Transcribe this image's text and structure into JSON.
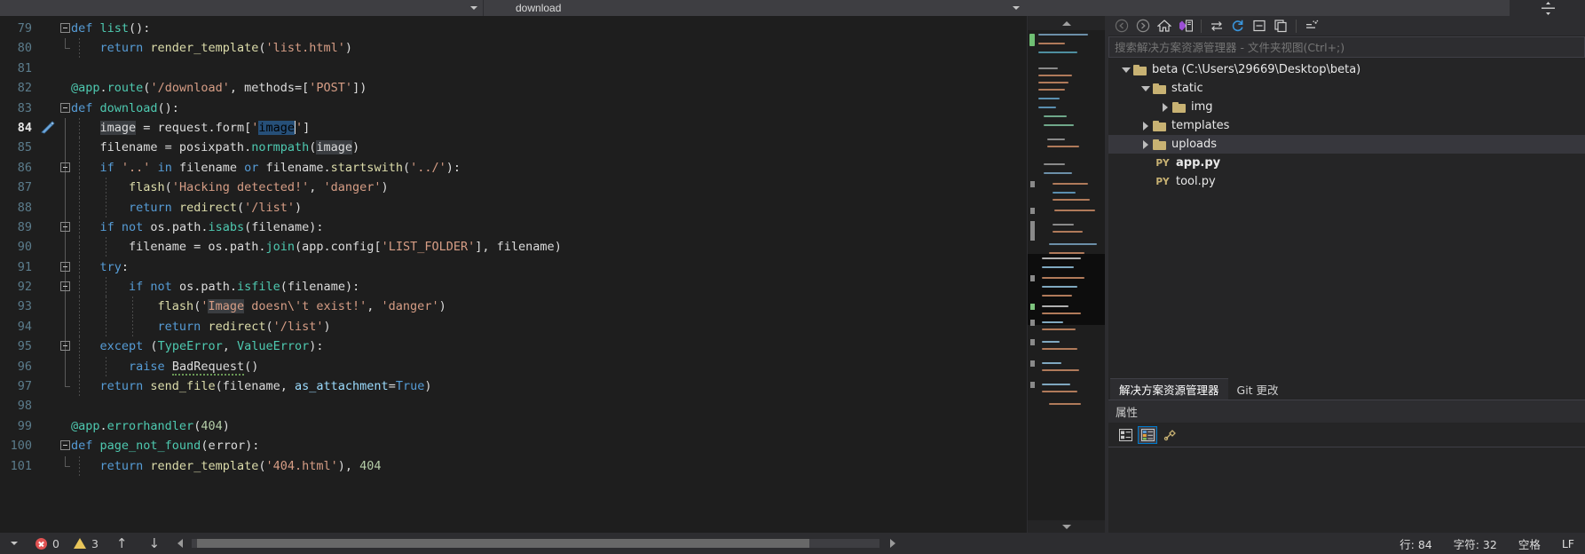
{
  "window": {
    "editor_tab_label": "download",
    "dropdown_icon": "caret-down-icon"
  },
  "editor": {
    "language": "python",
    "first_line_number": 79,
    "current_line": 84,
    "lines": [
      {
        "n": 79,
        "text": "def list():"
      },
      {
        "n": 80,
        "text": "    return render_template('list.html')"
      },
      {
        "n": 81,
        "text": ""
      },
      {
        "n": 82,
        "text": "@app.route('/download', methods=['POST'])"
      },
      {
        "n": 83,
        "text": "def download():"
      },
      {
        "n": 84,
        "text": "    image = request.form['image']"
      },
      {
        "n": 85,
        "text": "    filename = posixpath.normpath(image)"
      },
      {
        "n": 86,
        "text": "    if '..' in filename or filename.startswith('../'):"
      },
      {
        "n": 87,
        "text": "        flash('Hacking detected!', 'danger')"
      },
      {
        "n": 88,
        "text": "        return redirect('/list')"
      },
      {
        "n": 89,
        "text": "    if not os.path.isabs(filename):"
      },
      {
        "n": 90,
        "text": "        filename = os.path.join(app.config['LIST_FOLDER'], filename)"
      },
      {
        "n": 91,
        "text": "    try:"
      },
      {
        "n": 92,
        "text": "        if not os.path.isfile(filename):"
      },
      {
        "n": 93,
        "text": "            flash('Image doesn\\'t exist!', 'danger')"
      },
      {
        "n": 94,
        "text": "            return redirect('/list')"
      },
      {
        "n": 95,
        "text": "    except (TypeError, ValueError):"
      },
      {
        "n": 96,
        "text": "        raise BadRequest()"
      },
      {
        "n": 97,
        "text": "    return send_file(filename, as_attachment=True)"
      },
      {
        "n": 98,
        "text": ""
      },
      {
        "n": 99,
        "text": "@app.errorhandler(404)"
      },
      {
        "n": 100,
        "text": "def page_not_found(error):"
      },
      {
        "n": 101,
        "text": "    return render_template('404.html'), 404"
      }
    ],
    "selection_text": "image",
    "error_squiggle_token": "BadRequest"
  },
  "solution_explorer": {
    "search_placeholder": "搜索解决方案资源管理器 - 文件夹视图(Ctrl+;)",
    "toolbar_icons": [
      "back-arrow-icon",
      "forward-arrow-icon",
      "home-icon",
      "vs-solution-icon",
      "sync-icon",
      "refresh-icon",
      "collapse-all-icon",
      "copy-icon",
      "show-all-files-icon"
    ],
    "tree": [
      {
        "label": "beta (C:\\Users\\29669\\Desktop\\beta)",
        "depth": 0,
        "expanded": true,
        "type": "folder",
        "selected": false,
        "bold": false
      },
      {
        "label": "static",
        "depth": 1,
        "expanded": true,
        "type": "folder",
        "selected": false,
        "bold": false
      },
      {
        "label": "img",
        "depth": 2,
        "expanded": false,
        "type": "folder",
        "selected": false,
        "bold": false
      },
      {
        "label": "templates",
        "depth": 1,
        "expanded": false,
        "type": "folder",
        "selected": false,
        "bold": false
      },
      {
        "label": "uploads",
        "depth": 1,
        "expanded": false,
        "type": "folder",
        "selected": true,
        "bold": false
      },
      {
        "label": "app.py",
        "depth": 2,
        "expanded": null,
        "type": "py",
        "selected": false,
        "bold": true
      },
      {
        "label": "tool.py",
        "depth": 2,
        "expanded": null,
        "type": "py",
        "selected": false,
        "bold": false
      }
    ],
    "tabs": [
      {
        "label": "解决方案资源管理器",
        "active": true
      },
      {
        "label": "Git 更改",
        "active": false
      }
    ]
  },
  "properties": {
    "title": "属性",
    "buttons": [
      "categorized-view-icon",
      "alphabetical-view-icon",
      "properties-page-icon"
    ],
    "selected_button_index": 1
  },
  "status_bar": {
    "error_count": "0",
    "warning_count": "3",
    "nav_up_icon": "arrow-up-icon",
    "nav_down_icon": "arrow-down-icon",
    "line_label": "行: 84",
    "char_label": "字符: 32",
    "spaces_label": "空格",
    "eol_label": "LF"
  },
  "colors": {
    "editor_bg": "#1e1e1e",
    "chrome_bg": "#2d2d30",
    "panel_bg": "#252526",
    "keyword": "#569cd6",
    "function": "#4ec9b0",
    "string": "#d69d85",
    "number": "#b5cea8",
    "identifier": "#9cdcfe",
    "selection": "#264f78",
    "accent": "#007acc",
    "folder": "#c8b273"
  }
}
